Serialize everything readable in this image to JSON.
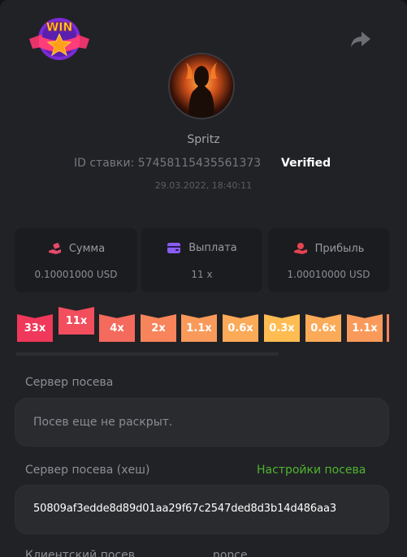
{
  "logo": {
    "text": "WIN"
  },
  "profile": {
    "username": "Spritz",
    "bet_id": "ID ставки: 57458115435561373",
    "verified": "Verified",
    "date": "29.03.2022, 18:40:11"
  },
  "stats": [
    {
      "label": "Сумма",
      "value": "0.10001000 USD",
      "icon": "money-hand-icon",
      "color": "#e84a6a"
    },
    {
      "label": "Выплата",
      "value": "11 x",
      "icon": "wallet-icon",
      "color": "#8a5cf6"
    },
    {
      "label": "Прибыль",
      "value": "1.00010000 USD",
      "icon": "profit-hand-icon",
      "color": "#e8434f"
    }
  ],
  "multipliers": [
    {
      "label": "33x",
      "color": "#f0385a"
    },
    {
      "label": "11x",
      "color": "#f24e5e"
    },
    {
      "label": "4x",
      "color": "#f46a5c"
    },
    {
      "label": "2x",
      "color": "#f7845a"
    },
    {
      "label": "1.1x",
      "color": "#f99a5a"
    },
    {
      "label": "0.6x",
      "color": "#fbaa58"
    },
    {
      "label": "0.3x",
      "color": "#ffbc52"
    },
    {
      "label": "0.6x",
      "color": "#fbaa58"
    },
    {
      "label": "1.1x",
      "color": "#f99a5a"
    }
  ],
  "seed": {
    "server_label": "Сервер посева",
    "server_value": "Посев еще не раскрыт.",
    "server_hash_label": "Сервер посева (хеш)",
    "settings_link": "Настройки посева",
    "server_hash_value": "50809af3edde8d89d01aa29f67c2547ded8d3b14d486aa3",
    "client_label": "Клиентский посев",
    "nonce_label": "nonce"
  }
}
